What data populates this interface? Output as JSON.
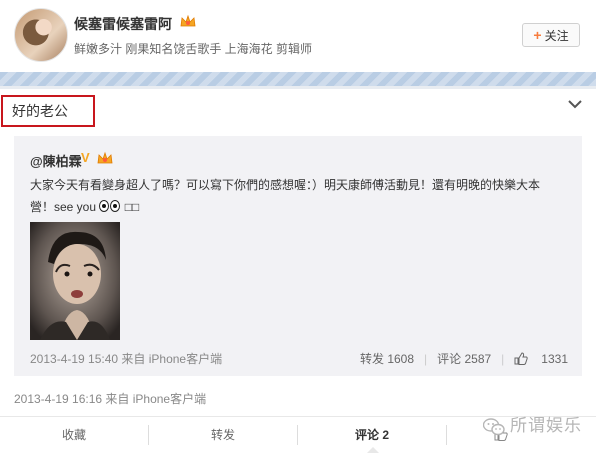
{
  "header": {
    "username": "候塞雷候塞雷阿",
    "bio": "鲜嫩多汁 刚果知名饶舌歌手 上海海花 剪辑师",
    "follow_label": "关注",
    "follow_symbol": "+"
  },
  "post": {
    "text": "好的老公",
    "timestamp_source": "2013-4-19 16:16 来自 iPhone客户端"
  },
  "repost": {
    "author": "@陳柏霖",
    "verified_badge": "V",
    "text_line1": "大家今天有看變身超人了嗎？可以寫下你們的感想喔：）明天康師傅活動見！還有明晚的快樂大本",
    "text_line2_prefix": "營！see you",
    "text_line2_suffix": "□□",
    "timestamp_source": "2013-4-19 15:40 来自 iPhone客户端",
    "repost_count": "转发 1608",
    "comment_count": "评论 2587",
    "like_count": "1331"
  },
  "actions": {
    "favorite": "收藏",
    "repost": "转发",
    "comment": "评论 2",
    "like": ""
  },
  "watermark": "所谓娱乐",
  "colors": {
    "highlight_border": "#c8161d",
    "repost_bg": "#f2f2f5",
    "vip_orange": "#f5a623",
    "follow_plus": "#f77c3d"
  }
}
